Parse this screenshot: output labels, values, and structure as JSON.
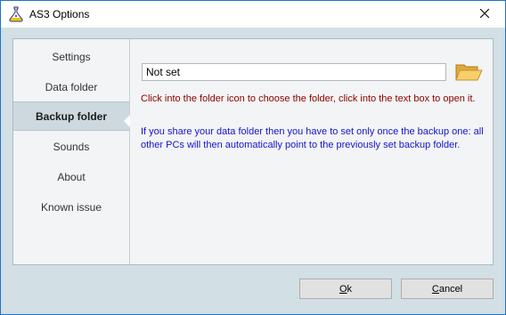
{
  "window": {
    "title": "AS3 Options",
    "close_glyph": "✕"
  },
  "sidebar": {
    "items": [
      {
        "label": "Settings",
        "selected": false
      },
      {
        "label": "Data folder",
        "selected": false
      },
      {
        "label": "Backup folder",
        "selected": true
      },
      {
        "label": "Sounds",
        "selected": false
      },
      {
        "label": "About",
        "selected": false
      },
      {
        "label": "Known issue",
        "selected": false
      }
    ]
  },
  "content": {
    "path_value": "Not set",
    "hint_open": "Click into the folder icon to choose the folder, click into the text box to open it.",
    "hint_shared": "If you share your data folder then you have to set only once the backup one:  all other PCs will  then automatically  point to  the previously  set backup folder."
  },
  "buttons": {
    "ok_first": "O",
    "ok_rest": "k",
    "cancel_first": "C",
    "cancel_rest": "ancel"
  },
  "icons": {
    "app": "flask-app-icon",
    "folder": "open-folder-icon",
    "close": "close-icon"
  },
  "colors": {
    "window_bg": "#d2dfe4",
    "panel_bg": "#f2f4f5",
    "selected_nav_bg": "#cdd9de",
    "hint_red": "#8b0000",
    "hint_blue": "#1515c8",
    "border_blue": "#1a73c9"
  }
}
